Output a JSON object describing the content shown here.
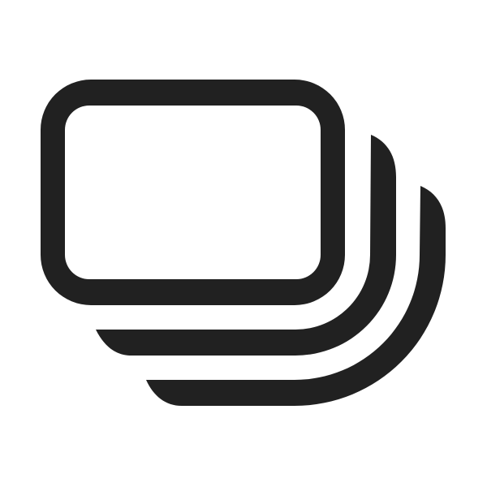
{
  "icon": {
    "name": "stacked-cards-icon",
    "color": "#212121",
    "background": "#ffffff"
  }
}
